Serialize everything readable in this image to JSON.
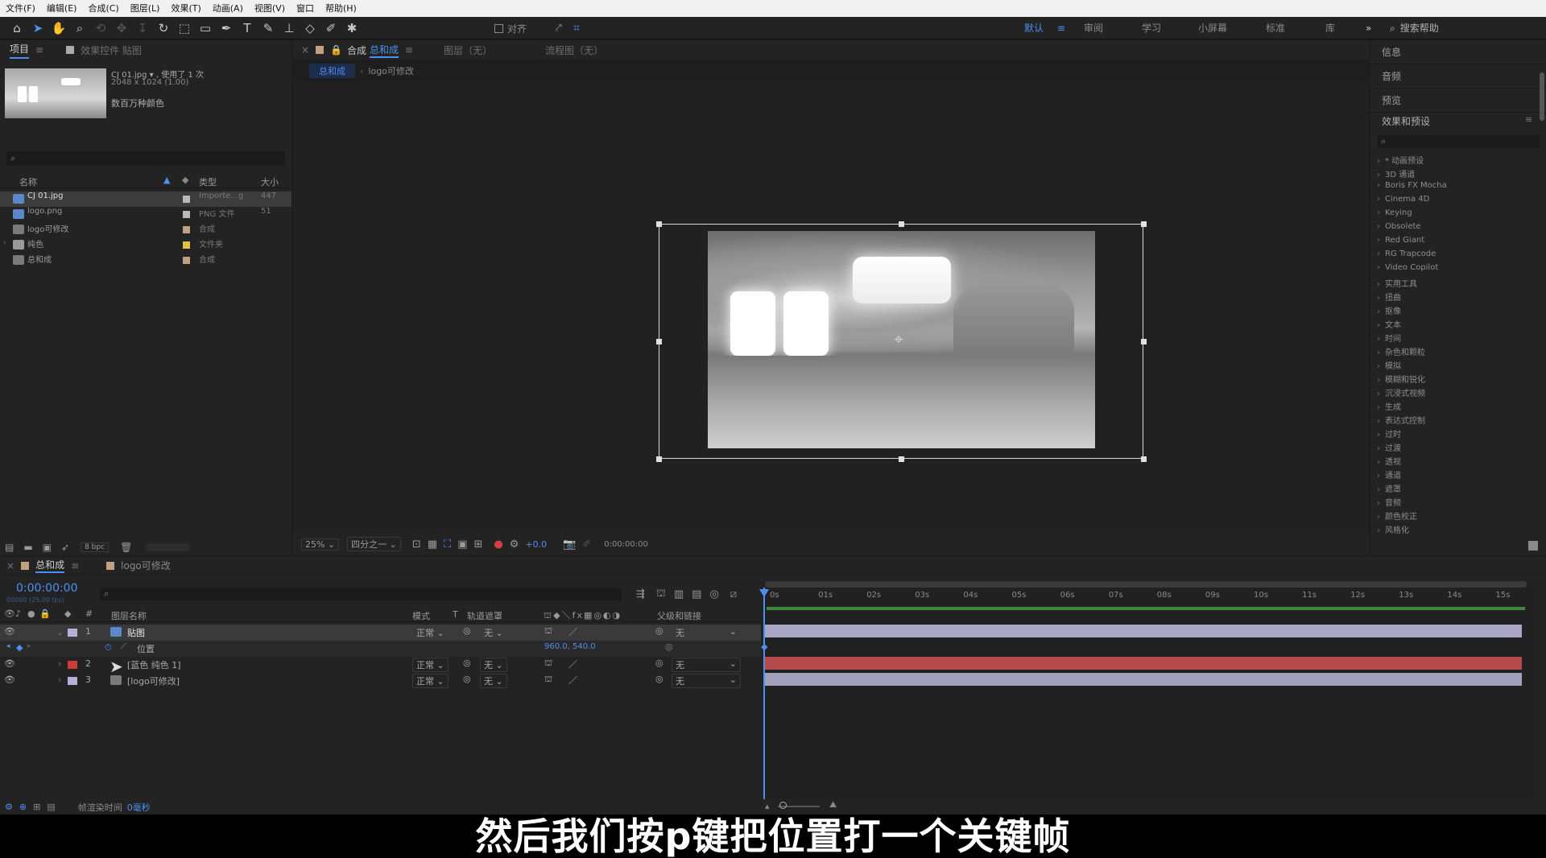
{
  "menu": [
    "文件(F)",
    "编辑(E)",
    "合成(C)",
    "图层(L)",
    "效果(T)",
    "动画(A)",
    "视图(V)",
    "窗口",
    "帮助(H)"
  ],
  "toolbar": {
    "snap_label": "对齐",
    "workspaces": [
      "默认",
      "审阅",
      "学习",
      "小屏幕",
      "标准",
      "库"
    ],
    "search_help": "搜索帮助"
  },
  "project": {
    "tab_project": "项目",
    "tab_effects": "效果控件 贴图",
    "preview_name": "CJ 01.jpg ▾ , 使用了 1 次",
    "preview_dims": "2048 x 1024 (1.00)",
    "preview_colors": "数百万种颜色",
    "col_name": "名称",
    "col_type": "类型",
    "col_size": "大小",
    "items": [
      {
        "name": "CJ 01.jpg",
        "type": "Importe...g",
        "size": "447",
        "label": "#b8b8b8",
        "selected": true
      },
      {
        "name": "logo.png",
        "type": "PNG 文件",
        "size": "51",
        "label": "#b8b8b8",
        "selected": false
      },
      {
        "name": "logo可修改",
        "type": "合成",
        "size": "",
        "label": "#c0a080",
        "selected": false
      },
      {
        "name": "纯色",
        "type": "文件夹",
        "size": "",
        "label": "#e0c040",
        "selected": false
      },
      {
        "name": "总和成",
        "type": "合成",
        "size": "",
        "label": "#c0a080",
        "selected": false
      }
    ],
    "bpc": "8 bpc"
  },
  "comp": {
    "tab_label": "合成",
    "tab_comp_name": "总和成",
    "layer_tab": "图层（无）",
    "flow_tab": "流程图（无）",
    "crumb_active": "总和成",
    "crumb_other": "logo可修改",
    "zoom": "25%",
    "resolution": "四分之一",
    "exposure": "+0.0",
    "timecode": "0:00:00:00"
  },
  "right": {
    "sections": [
      "信息",
      "音频",
      "预览"
    ],
    "effects_title": "效果和预设",
    "effects": [
      "* 动画预设",
      "3D 通道",
      "Boris FX Mocha",
      "Cinema 4D",
      "Keying",
      "Obsolete",
      "Red Giant",
      "RG Trapcode",
      "Video Copilot",
      "实用工具",
      "扭曲",
      "抠像",
      "文本",
      "时间",
      "杂色和颗粒",
      "模拟",
      "模糊和锐化",
      "沉浸式视频",
      "生成",
      "表达式控制",
      "过时",
      "过渡",
      "透视",
      "通道",
      "遮罩",
      "音频",
      "颜色校正",
      "风格化"
    ]
  },
  "timeline": {
    "tab_active": "总和成",
    "tab_other": "logo可修改",
    "timecode": "0:00:00:00",
    "timecode_sub": "00000 (25.00 fps)",
    "col_layer_name": "图层名称",
    "col_mode": "模式",
    "col_t": "T",
    "col_track": "轨道遮罩",
    "col_parent": "父级和链接",
    "ruler": [
      "0s",
      "01s",
      "02s",
      "03s",
      "04s",
      "05s",
      "06s",
      "07s",
      "08s",
      "09s",
      "10s",
      "11s",
      "12s",
      "13s",
      "14s",
      "15s"
    ],
    "layers": [
      {
        "num": "1",
        "name": "贴图",
        "mode": "正常",
        "track": "无",
        "parent": "无",
        "label": "#b3b1d8",
        "bar": "#a9a7c8"
      },
      {
        "num": "2",
        "name": "[蓝色 纯色 1]",
        "mode": "正常",
        "track": "无",
        "parent": "无",
        "label": "#d23a3a",
        "bar": "#b54848"
      },
      {
        "num": "3",
        "name": "[logo可修改]",
        "mode": "正常",
        "track": "无",
        "parent": "无",
        "label": "#b3b1d8",
        "bar": "#a3a1ba"
      }
    ],
    "property_name": "位置",
    "property_value": "960.0, 540.0"
  },
  "status": {
    "render_label": "帧渲染时间",
    "render_value": "0毫秒"
  },
  "subtitle": "然后我们按p键把位置打一个关键帧",
  "colors": {
    "accent": "#4c8ff0",
    "panel": "#232323",
    "background": "#1d1d1d"
  }
}
